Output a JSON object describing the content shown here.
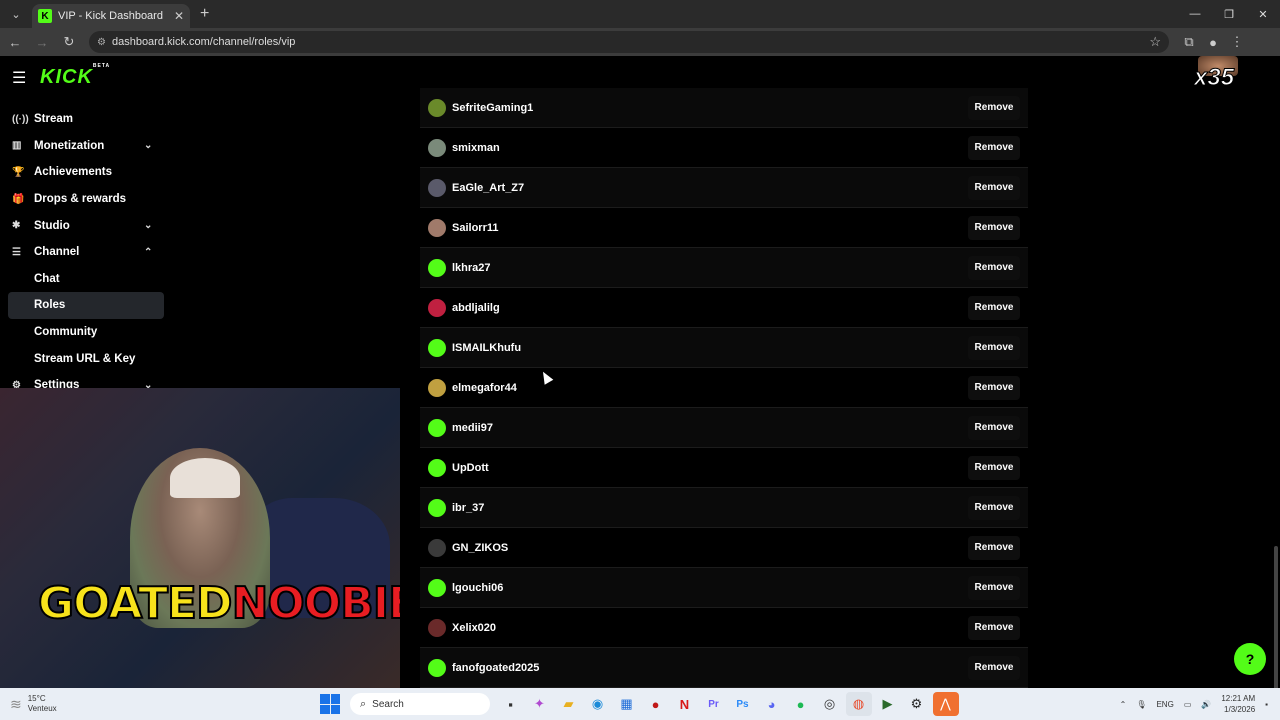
{
  "browser": {
    "tab_title": "VIP - Kick Dashboard",
    "tab_favicon": "K",
    "url": "dashboard.kick.com/channel/roles/vip",
    "new_tab_icon": "+",
    "close_icon": "✕"
  },
  "app": {
    "logo": "KICK",
    "logo_badge": "BETA",
    "sidebar": [
      {
        "label": "Stream",
        "icon": "broadcast-icon",
        "glyph": "((·))",
        "sub": false,
        "chevron": ""
      },
      {
        "label": "Monetization",
        "icon": "chart-icon",
        "glyph": "▥",
        "sub": false,
        "chevron": "⌄"
      },
      {
        "label": "Achievements",
        "icon": "trophy-icon",
        "glyph": "🏆",
        "sub": false,
        "chevron": ""
      },
      {
        "label": "Drops & rewards",
        "icon": "gift-icon",
        "glyph": "🎁",
        "sub": false,
        "chevron": ""
      },
      {
        "label": "Studio",
        "icon": "studio-icon",
        "glyph": "✱",
        "sub": false,
        "chevron": "⌄"
      },
      {
        "label": "Channel",
        "icon": "channel-icon",
        "glyph": "☰",
        "sub": false,
        "chevron": "⌃"
      },
      {
        "label": "Chat",
        "icon": "",
        "glyph": "",
        "sub": true,
        "chevron": ""
      },
      {
        "label": "Roles",
        "icon": "",
        "glyph": "",
        "sub": true,
        "chevron": "",
        "active": true
      },
      {
        "label": "Community",
        "icon": "",
        "glyph": "",
        "sub": true,
        "chevron": ""
      },
      {
        "label": "Stream URL & Key",
        "icon": "",
        "glyph": "",
        "sub": true,
        "chevron": ""
      },
      {
        "label": "Settings",
        "icon": "settings-icon",
        "glyph": "⚙",
        "sub": false,
        "chevron": "⌄"
      }
    ],
    "vip_list": [
      {
        "name": "SefriteGaming1",
        "avatar_color": "#6a8a2a"
      },
      {
        "name": "smixman",
        "avatar_color": "#7a8a7a"
      },
      {
        "name": "EaGle_Art_Z7",
        "avatar_color": "#5a5a6a"
      },
      {
        "name": "Sailorr11",
        "avatar_color": "#a07a6a"
      },
      {
        "name": "lkhra27",
        "avatar_color": "#53fc18"
      },
      {
        "name": "abdljalilg",
        "avatar_color": "#c02040"
      },
      {
        "name": "ISMAILKhufu",
        "avatar_color": "#53fc18"
      },
      {
        "name": "elmegafor44",
        "avatar_color": "#c0a040"
      },
      {
        "name": "medii97",
        "avatar_color": "#53fc18"
      },
      {
        "name": "UpDott",
        "avatar_color": "#53fc18"
      },
      {
        "name": "ibr_37",
        "avatar_color": "#53fc18"
      },
      {
        "name": "GN_ZIKOS",
        "avatar_color": "#3a3a3a"
      },
      {
        "name": "lgouchi06",
        "avatar_color": "#53fc18"
      },
      {
        "name": "Xelix020",
        "avatar_color": "#6a2a2a"
      },
      {
        "name": "fanofgoated2025",
        "avatar_color": "#53fc18"
      }
    ],
    "remove_label": "Remove",
    "overlay_counter": "x35",
    "stream_brand_a": "GOATED",
    "stream_brand_b": "NOOBIE",
    "accent": "#53fc18"
  },
  "taskbar": {
    "temperature": "15°C",
    "weather": "Venteux",
    "search_placeholder": "Search",
    "language": "ENG",
    "time": "12:21 AM",
    "date": "1/3/2026"
  }
}
